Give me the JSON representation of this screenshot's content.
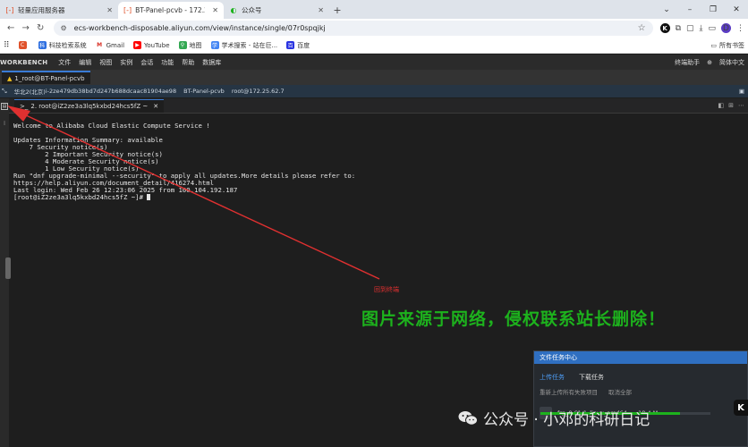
{
  "browser": {
    "tabs": [
      {
        "label": "轻量应用服务器",
        "icon_color": "#e0522b",
        "active": false
      },
      {
        "label": "BT-Panel-pcvb - 172.25.62.7",
        "icon_color": "#e0522b",
        "active": true
      },
      {
        "label": "公众号",
        "icon_color": "#1db21d",
        "active": false
      }
    ],
    "new_tab": "+",
    "window_controls": [
      "⌄",
      "–",
      "❐",
      "✕"
    ],
    "url": "ecs-workbench-disposable.aliyun.com/view/instance/single/07r0spqjkj",
    "profile_initial": "D"
  },
  "bookmarks": {
    "items": [
      {
        "label": "",
        "color": "#e0522b",
        "glyph": "C"
      },
      {
        "label": "科技检索系统",
        "color": "#2e6fe0",
        "glyph": "科"
      },
      {
        "label": "Gmail",
        "color": "#d93025",
        "glyph": "M"
      },
      {
        "label": "YouTube",
        "color": "#ff0000",
        "glyph": "▶"
      },
      {
        "label": "地图",
        "color": "#34a853",
        "glyph": "⚲"
      },
      {
        "label": "学术搜索 - 站在巨...",
        "color": "#4285f4",
        "glyph": "学"
      },
      {
        "label": "百度",
        "color": "#2932e1",
        "glyph": "百"
      }
    ],
    "all_bookmarks": "所有书签"
  },
  "workbench": {
    "brand": "WORKBENCH",
    "menu": [
      "文件",
      "编辑",
      "视图",
      "实例",
      "会话",
      "功能",
      "帮助",
      "数据库"
    ],
    "right": [
      "终端助手",
      "⊕",
      "简体中文"
    ]
  },
  "session": {
    "tab_label": "1_root@BT-Panel-pcvb",
    "info": [
      "华北2(北京)",
      "i-2ze479db38bd7d247b688dcaac81904ae98",
      "BT-Panel-pcvb",
      "root@172.25.62.7"
    ]
  },
  "terminal_tab": {
    "label": "2. root@iZ2ze3a3lq5kxbd24hcs5fZ ~"
  },
  "terminal": {
    "lines": [
      "Welcome to Alibaba Cloud Elastic Compute Service !",
      "",
      "Updates Information Summary: available",
      "    7 Security notice(s)",
      "        2 Important Security notice(s)",
      "        4 Moderate Security notice(s)",
      "        1 Low Security notice(s)",
      "Run \"dnf upgrade-minimal --security\" to apply all updates.More details please refer to:",
      "https://help.aliyun.com/document_detail/416274.html",
      "Last login: Wed Feb 26 12:23:06 2025 from 100.104.192.187"
    ],
    "prompt": "[root@iZ2ze3a3lq5kxbd24hcs5fZ ~]# "
  },
  "annotation": "回到终端",
  "overlay_text": "图片来源于网络，侵权联系站长删除！",
  "file_panel": {
    "title": "文件任务中心",
    "tabs": [
      "上传任务",
      "下载任务"
    ],
    "actions": [
      "重新上传所有失败项目",
      "取消全部"
    ],
    "file_name": "frp_0.61.1_linux_amd64...",
    "file_size": "18.4 M",
    "progress": 0.82
  },
  "wechat": {
    "text": "公众号 · 小邓的科研日记"
  },
  "colors": {
    "accent": "#2f6fc1",
    "annotation_red": "#e03030",
    "overlay_green": "#1db21d"
  }
}
